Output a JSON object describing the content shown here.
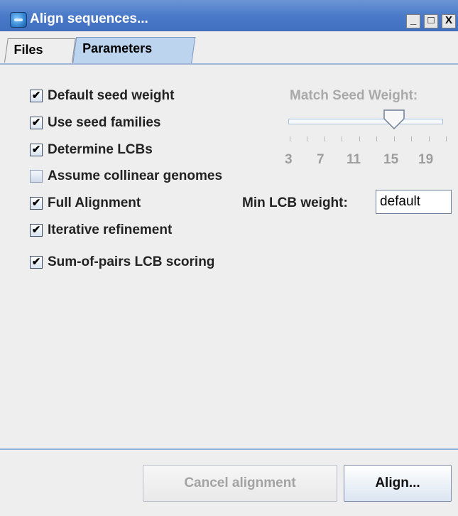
{
  "window": {
    "title": "Align sequences...",
    "controls": {
      "minimize": "_",
      "maximize": "□",
      "close": "X"
    }
  },
  "tabs": [
    {
      "label": "Files",
      "selected": false
    },
    {
      "label": "Parameters",
      "selected": true
    }
  ],
  "options": [
    {
      "label": "Default seed weight",
      "checked": true
    },
    {
      "label": "Use seed families",
      "checked": true
    },
    {
      "label": "Determine LCBs",
      "checked": true
    },
    {
      "label": "Assume collinear genomes",
      "checked": false
    },
    {
      "label": "Full Alignment",
      "checked": true
    },
    {
      "label": "Iterative refinement",
      "checked": true
    },
    {
      "label": "Sum-of-pairs LCB scoring",
      "checked": true
    }
  ],
  "seed_weight": {
    "label": "Match Seed Weight:",
    "tick_labels": [
      "3",
      "7",
      "11",
      "15",
      "19"
    ],
    "value": 15,
    "min": 3,
    "max": 21,
    "enabled": false
  },
  "min_lcb": {
    "label": "Min LCB weight:",
    "value": "default"
  },
  "buttons": {
    "cancel": "Cancel alignment",
    "align": "Align..."
  },
  "colors": {
    "titlebar": "#4a7ac8",
    "selected_tab": "#bcd4ee",
    "disabled_text": "#a9a9a9"
  }
}
